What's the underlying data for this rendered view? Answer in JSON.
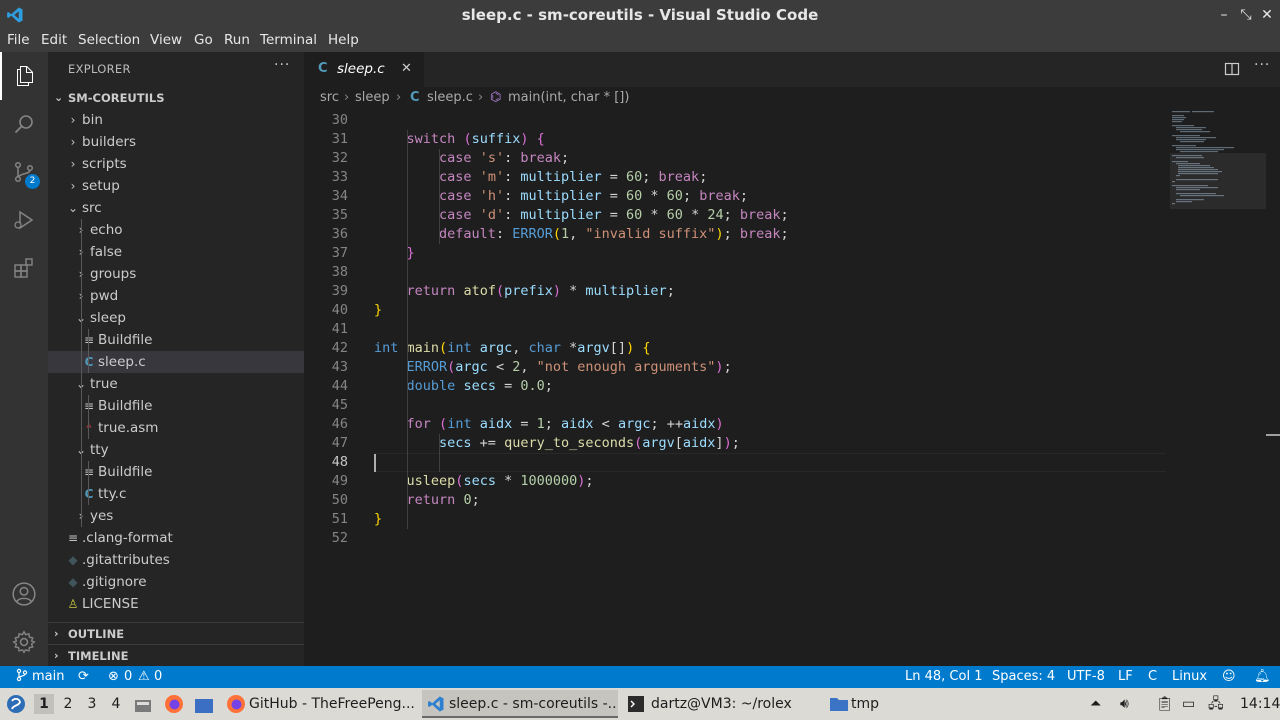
{
  "window": {
    "title": "sleep.c - sm-coreutils - Visual Studio Code",
    "controls": [
      "–",
      "⤡",
      "✕"
    ]
  },
  "menu": [
    "File",
    "Edit",
    "Selection",
    "View",
    "Go",
    "Run",
    "Terminal",
    "Help"
  ],
  "activity_bar": {
    "items": [
      "explorer",
      "search",
      "source-control",
      "run-debug",
      "extensions"
    ],
    "source_control_badge": "2",
    "bottom": [
      "accounts",
      "manage"
    ]
  },
  "explorer": {
    "title": "EXPLORER",
    "more": "···",
    "root": "SM-COREUTILS",
    "tree": [
      {
        "label": "bin",
        "kind": "folder",
        "open": false,
        "depth": 0
      },
      {
        "label": "builders",
        "kind": "folder",
        "open": false,
        "depth": 0
      },
      {
        "label": "scripts",
        "kind": "folder",
        "open": false,
        "depth": 0
      },
      {
        "label": "setup",
        "kind": "folder",
        "open": false,
        "depth": 0
      },
      {
        "label": "src",
        "kind": "folder",
        "open": true,
        "depth": 0
      },
      {
        "label": "echo",
        "kind": "folder",
        "open": false,
        "depth": 1
      },
      {
        "label": "false",
        "kind": "folder",
        "open": false,
        "depth": 1
      },
      {
        "label": "groups",
        "kind": "folder",
        "open": false,
        "depth": 1
      },
      {
        "label": "pwd",
        "kind": "folder",
        "open": false,
        "depth": 1
      },
      {
        "label": "sleep",
        "kind": "folder",
        "open": true,
        "depth": 1
      },
      {
        "label": "Buildfile",
        "kind": "file-text",
        "depth": 2
      },
      {
        "label": "sleep.c",
        "kind": "file-c",
        "depth": 2,
        "selected": true
      },
      {
        "label": "true",
        "kind": "folder",
        "open": true,
        "depth": 1
      },
      {
        "label": "Buildfile",
        "kind": "file-text",
        "depth": 2
      },
      {
        "label": "true.asm",
        "kind": "file-asm",
        "depth": 2
      },
      {
        "label": "tty",
        "kind": "folder",
        "open": true,
        "depth": 1
      },
      {
        "label": "Buildfile",
        "kind": "file-text",
        "depth": 2
      },
      {
        "label": "tty.c",
        "kind": "file-c",
        "depth": 2
      },
      {
        "label": "yes",
        "kind": "folder",
        "open": false,
        "depth": 1
      },
      {
        "label": ".clang-format",
        "kind": "file-text",
        "depth": 0
      },
      {
        "label": ".gitattributes",
        "kind": "file-git",
        "depth": 0
      },
      {
        "label": ".gitignore",
        "kind": "file-git",
        "depth": 0
      },
      {
        "label": "LICENSE",
        "kind": "file-license",
        "depth": 0
      }
    ],
    "outline": "OUTLINE",
    "timeline": "TIMELINE"
  },
  "tab": {
    "icon": "C",
    "label": "sleep.c",
    "close": "✕"
  },
  "breadcrumbs": [
    "src",
    "sleep",
    "sleep.c",
    "main(int, char * [])"
  ],
  "editor": {
    "current_line": 48,
    "lines": [
      {
        "n": 30,
        "code": []
      },
      {
        "n": 31,
        "code": [
          [
            "",
            "    "
          ],
          [
            "ctl",
            "switch"
          ],
          [
            "",
            " "
          ],
          [
            "brk2",
            "("
          ],
          [
            "var",
            "suffix"
          ],
          [
            "brk2",
            ")"
          ],
          [
            "",
            " "
          ],
          [
            "brk2",
            "{"
          ]
        ]
      },
      {
        "n": 32,
        "code": [
          [
            "",
            "        "
          ],
          [
            "ctl",
            "case"
          ],
          [
            "",
            " "
          ],
          [
            "str",
            "'s'"
          ],
          [
            "",
            ": "
          ],
          [
            "ctl",
            "break"
          ],
          [
            "",
            ";"
          ]
        ]
      },
      {
        "n": 33,
        "code": [
          [
            "",
            "        "
          ],
          [
            "ctl",
            "case"
          ],
          [
            "",
            " "
          ],
          [
            "str",
            "'m'"
          ],
          [
            "",
            ": "
          ],
          [
            "var",
            "multiplier"
          ],
          [
            "",
            " = "
          ],
          [
            "num",
            "60"
          ],
          [
            "",
            "; "
          ],
          [
            "ctl",
            "break"
          ],
          [
            "",
            ";"
          ]
        ]
      },
      {
        "n": 34,
        "code": [
          [
            "",
            "        "
          ],
          [
            "ctl",
            "case"
          ],
          [
            "",
            " "
          ],
          [
            "str",
            "'h'"
          ],
          [
            "",
            ": "
          ],
          [
            "var",
            "multiplier"
          ],
          [
            "",
            " = "
          ],
          [
            "num",
            "60"
          ],
          [
            "",
            " * "
          ],
          [
            "num",
            "60"
          ],
          [
            "",
            "; "
          ],
          [
            "ctl",
            "break"
          ],
          [
            "",
            ";"
          ]
        ]
      },
      {
        "n": 35,
        "code": [
          [
            "",
            "        "
          ],
          [
            "ctl",
            "case"
          ],
          [
            "",
            " "
          ],
          [
            "str",
            "'d'"
          ],
          [
            "",
            ": "
          ],
          [
            "var",
            "multiplier"
          ],
          [
            "",
            " = "
          ],
          [
            "num",
            "60"
          ],
          [
            "",
            " * "
          ],
          [
            "num",
            "60"
          ],
          [
            "",
            " * "
          ],
          [
            "num",
            "24"
          ],
          [
            "",
            "; "
          ],
          [
            "ctl",
            "break"
          ],
          [
            "",
            ";"
          ]
        ]
      },
      {
        "n": 36,
        "code": [
          [
            "",
            "        "
          ],
          [
            "ctl",
            "default"
          ],
          [
            "",
            ": "
          ],
          [
            "mac",
            "ERROR"
          ],
          [
            "brk",
            "("
          ],
          [
            "num",
            "1"
          ],
          [
            "",
            ", "
          ],
          [
            "str",
            "\"invalid suffix\""
          ],
          [
            "brk",
            ")"
          ],
          [
            "",
            "; "
          ],
          [
            "ctl",
            "break"
          ],
          [
            "",
            ";"
          ]
        ]
      },
      {
        "n": 37,
        "code": [
          [
            "",
            "    "
          ],
          [
            "brk2",
            "}"
          ]
        ]
      },
      {
        "n": 38,
        "code": []
      },
      {
        "n": 39,
        "code": [
          [
            "",
            "    "
          ],
          [
            "ctl",
            "return"
          ],
          [
            "",
            " "
          ],
          [
            "fn",
            "atof"
          ],
          [
            "brk2",
            "("
          ],
          [
            "var",
            "prefix"
          ],
          [
            "brk2",
            ")"
          ],
          [
            "",
            " * "
          ],
          [
            "var",
            "multiplier"
          ],
          [
            "",
            ";"
          ]
        ]
      },
      {
        "n": 40,
        "code": [
          [
            "brk",
            "}"
          ]
        ]
      },
      {
        "n": 41,
        "code": []
      },
      {
        "n": 42,
        "code": [
          [
            "kw",
            "int"
          ],
          [
            "",
            " "
          ],
          [
            "fn",
            "main"
          ],
          [
            "brk",
            "("
          ],
          [
            "kw",
            "int"
          ],
          [
            "",
            " "
          ],
          [
            "var",
            "argc"
          ],
          [
            "",
            ", "
          ],
          [
            "kw",
            "char"
          ],
          [
            "",
            " *"
          ],
          [
            "var",
            "argv"
          ],
          [
            "",
            "[]"
          ],
          [
            "brk",
            ")"
          ],
          [
            "",
            " "
          ],
          [
            "brk",
            "{"
          ]
        ]
      },
      {
        "n": 43,
        "code": [
          [
            "",
            "    "
          ],
          [
            "mac",
            "ERROR"
          ],
          [
            "brk2",
            "("
          ],
          [
            "var",
            "argc"
          ],
          [
            "",
            " < "
          ],
          [
            "num",
            "2"
          ],
          [
            "",
            ", "
          ],
          [
            "str",
            "\"not enough arguments\""
          ],
          [
            "brk2",
            ")"
          ],
          [
            "",
            ";"
          ]
        ]
      },
      {
        "n": 44,
        "code": [
          [
            "",
            "    "
          ],
          [
            "kw",
            "double"
          ],
          [
            "",
            " "
          ],
          [
            "var",
            "secs"
          ],
          [
            "",
            " = "
          ],
          [
            "num",
            "0.0"
          ],
          [
            "",
            ";"
          ]
        ]
      },
      {
        "n": 45,
        "code": []
      },
      {
        "n": 46,
        "code": [
          [
            "",
            "    "
          ],
          [
            "ctl",
            "for"
          ],
          [
            "",
            " "
          ],
          [
            "brk2",
            "("
          ],
          [
            "kw",
            "int"
          ],
          [
            "",
            " "
          ],
          [
            "var",
            "aidx"
          ],
          [
            "",
            " = "
          ],
          [
            "num",
            "1"
          ],
          [
            "",
            "; "
          ],
          [
            "var",
            "aidx"
          ],
          [
            "",
            " < "
          ],
          [
            "var",
            "argc"
          ],
          [
            "",
            "; ++"
          ],
          [
            "var",
            "aidx"
          ],
          [
            "brk2",
            ")"
          ]
        ]
      },
      {
        "n": 47,
        "code": [
          [
            "",
            "        "
          ],
          [
            "var",
            "secs"
          ],
          [
            "",
            " += "
          ],
          [
            "fn",
            "query_to_seconds"
          ],
          [
            "brk2",
            "("
          ],
          [
            "var",
            "argv"
          ],
          [
            "",
            "["
          ],
          [
            "var",
            "aidx"
          ],
          [
            "",
            "]"
          ],
          [
            "brk2",
            ")"
          ],
          [
            "",
            ";"
          ]
        ]
      },
      {
        "n": 48,
        "code": []
      },
      {
        "n": 49,
        "code": [
          [
            "",
            "    "
          ],
          [
            "fn",
            "usleep"
          ],
          [
            "brk2",
            "("
          ],
          [
            "var",
            "secs"
          ],
          [
            "",
            " * "
          ],
          [
            "num",
            "1000000"
          ],
          [
            "brk2",
            ")"
          ],
          [
            "",
            ";"
          ]
        ]
      },
      {
        "n": 50,
        "code": [
          [
            "",
            "    "
          ],
          [
            "ctl",
            "return"
          ],
          [
            "",
            " "
          ],
          [
            "num",
            "0"
          ],
          [
            "",
            ";"
          ]
        ]
      },
      {
        "n": 51,
        "code": [
          [
            "brk",
            "}"
          ]
        ]
      },
      {
        "n": 52,
        "code": []
      }
    ]
  },
  "status": {
    "branch": "main",
    "errors": "0",
    "warnings": "0",
    "position": "Ln 48, Col 1",
    "spaces": "Spaces: 4",
    "encoding": "UTF-8",
    "eol": "LF",
    "language": "C",
    "platform": "Linux"
  },
  "taskbar": {
    "workspaces": [
      "1",
      "2",
      "3",
      "4"
    ],
    "active_workspace": "1",
    "tasks": [
      {
        "label": "GitHub - TheFreePeng...",
        "icon": "firefox"
      },
      {
        "label": "sleep.c - sm-coreutils -...",
        "icon": "vscode",
        "active": true
      },
      {
        "label": "dartz@VM3: ~/rolex",
        "icon": "terminal"
      },
      {
        "label": "tmp",
        "icon": "folder"
      }
    ],
    "clock": "14:14"
  }
}
